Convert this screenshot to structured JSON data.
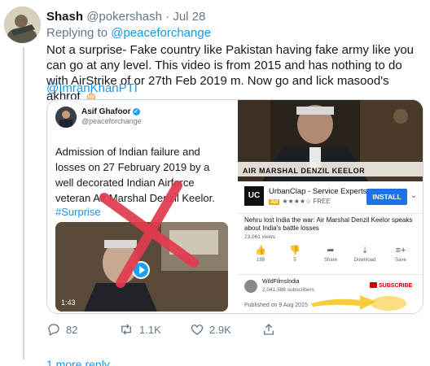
{
  "tweet": {
    "author_name": "Shash",
    "author_handle": "@pokershash",
    "separator": "·",
    "date": "Jul 28",
    "replying_prefix": "Replying to ",
    "replying_to": "@peaceforchange",
    "text": "Not a surprise- Fake country like Pakistan having fake army like you can go at any level. This video is from 2015 and has nothing to do with AirStrike of or 27th Feb 2019 m. Now go and lick masood's akhrot 🖕🏻",
    "mention": "@ImranKhanPTI"
  },
  "embedded_tweet": {
    "name": "Asif Ghafoor",
    "verified_mark": "✓",
    "handle": "@peaceforchange",
    "text": "Admission of Indian failure and losses on 27 February 2019 by a well decorated Indian Airforce veteran Air Marshal Denzil Keelor.",
    "hashtag": "#Surprise",
    "video_duration": "1:43"
  },
  "youtube": {
    "video_caption": "AIR MARSHAL DENZIL KEELOR",
    "ad": {
      "logo": "UC",
      "name": "UrbanClap - Service Experts",
      "badge": "Ad",
      "rating": "★★★★☆",
      "price": "FREE",
      "install_label": "INSTALL"
    },
    "title": "Nehru lost India the war: Air Marshal Denzil Keelor speaks about India's battle losses",
    "views": "23,061 views",
    "actions": [
      {
        "icon": "thumbs-up-icon",
        "glyph": "👍",
        "label": "199"
      },
      {
        "icon": "thumbs-down-icon",
        "glyph": "👎",
        "label": "5"
      },
      {
        "icon": "share-icon",
        "glyph": "➦",
        "label": "Share"
      },
      {
        "icon": "download-icon",
        "glyph": "⤓",
        "label": "Download"
      },
      {
        "icon": "save-icon",
        "glyph": "≡+",
        "label": "Save"
      }
    ],
    "channel_name": "WildFilmsIndia",
    "channel_subscribers": "2,041,588 subscribers",
    "subscribe_label": "SUBSCRIBE",
    "published": "Published on 9 Aug 2015"
  },
  "action_bar": {
    "replies": "82",
    "retweets": "1.1K",
    "likes": "2.9K"
  },
  "more_replies": "1 more reply",
  "colors": {
    "link": "#1b95e0",
    "muted": "#657786",
    "cross": "#e23a4e",
    "install": "#1a73e8",
    "subscribe": "#cc0000"
  }
}
